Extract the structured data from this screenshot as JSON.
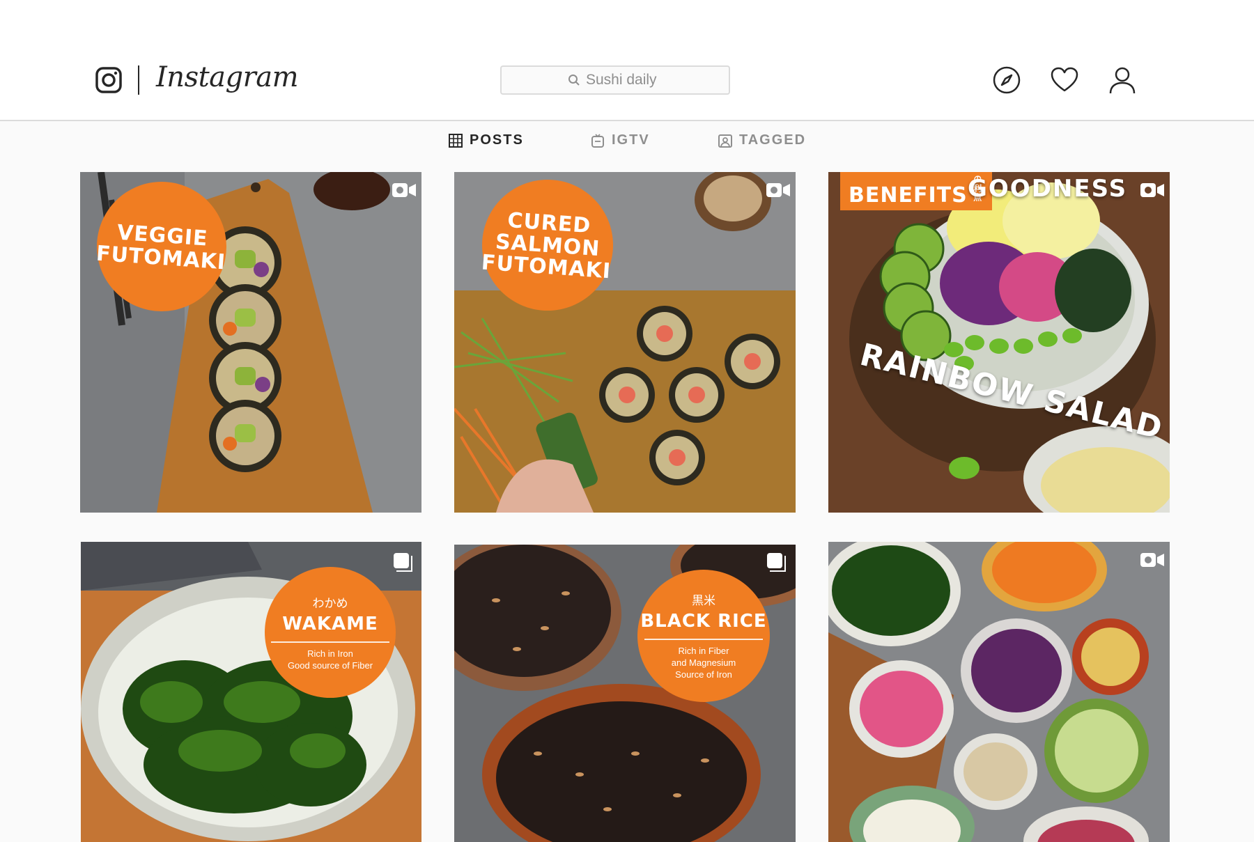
{
  "header": {
    "wordmark": "Instagram",
    "search": {
      "value": "",
      "placeholder": "Sushi daily"
    },
    "icons": [
      "compass-icon",
      "heart-icon",
      "profile-icon"
    ]
  },
  "tabs": [
    {
      "label": "POSTS",
      "icon": "grid-icon",
      "active": true
    },
    {
      "label": "IGTV",
      "icon": "igtv-icon",
      "active": false
    },
    {
      "label": "TAGGED",
      "icon": "tagged-icon",
      "active": false
    }
  ],
  "colors": {
    "accent": "#f07d22",
    "text": "#262626",
    "muted": "#8e8e8e",
    "border": "#dbdbdb"
  },
  "posts": [
    {
      "type": "video",
      "badge": "VEGGIE\nFUTOMAKI"
    },
    {
      "type": "video",
      "badge": "CURED\nSALMON\nFUTOMAKI"
    },
    {
      "type": "video",
      "tag": "BENEFITS",
      "tag_jp": "の利点",
      "heading": "GOODNESS",
      "curve": "RAINBOW SALAD"
    },
    {
      "type": "carousel",
      "jp": "わかめ",
      "title": "WAKAME",
      "sub": "Rich in Iron\nGood source of Fiber"
    },
    {
      "type": "carousel",
      "jp": "黒米",
      "title": "BLACK RICE",
      "sub": "Rich in Fiber\nand Magnesium\nSource of Iron"
    },
    {
      "type": "video"
    }
  ]
}
